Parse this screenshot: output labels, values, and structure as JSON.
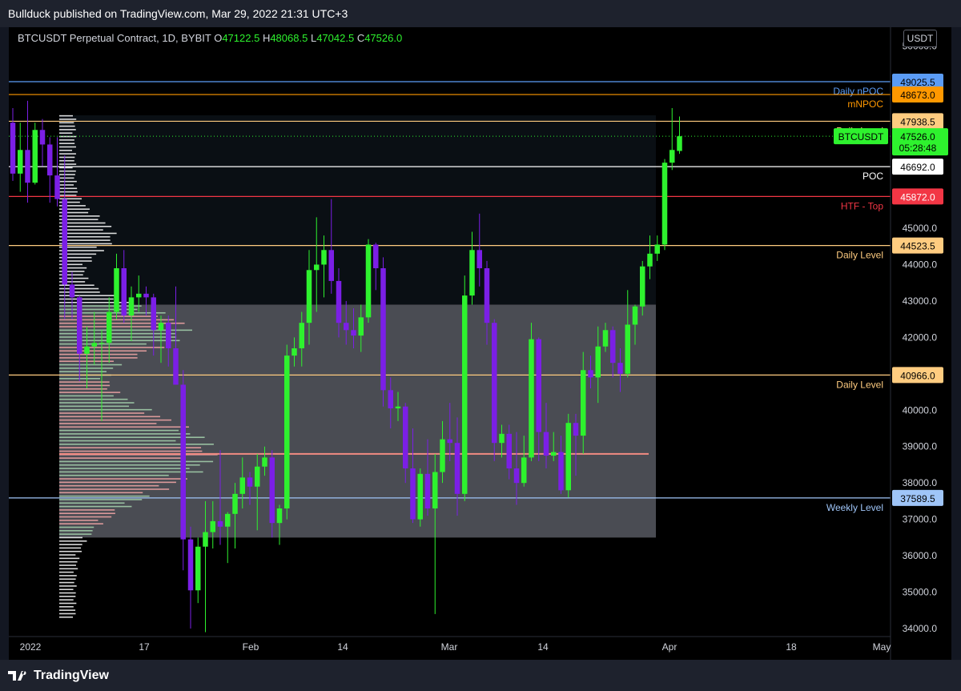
{
  "header": {
    "published": "Bullduck published on TradingView.com, Mar 29, 2022 21:31 UTC+3"
  },
  "legend": {
    "symbol": "BTCUSDT Perpetual Contract, 1D, BYBIT",
    "o_label": "O",
    "o": "47122.5",
    "h_label": "H",
    "h": "48068.5",
    "l_label": "L",
    "l": "47042.5",
    "c_label": "C",
    "c": "47526.0"
  },
  "currency": "USDT",
  "brand": "TradingView",
  "chart_data": {
    "type": "candlestick",
    "symbol": "BTCUSDT",
    "timeframe": "1D",
    "ylim": [
      34000,
      50000
    ],
    "y_ticks": [
      "34000.0",
      "35000.0",
      "36000.0",
      "37000.0",
      "38000.0",
      "39000.0",
      "40000.0",
      "41000.0",
      "42000.0",
      "43000.0",
      "44000.0",
      "45000.0",
      "50000.0"
    ],
    "x_ticks": [
      "2022",
      "17",
      "Feb",
      "14",
      "Mar",
      "14",
      "Apr",
      "18",
      "May"
    ],
    "last_price": "47526.0",
    "countdown": "05:28:48",
    "symbol_tag": "BTCUSDT",
    "levels": [
      {
        "value": 49025.5,
        "label": "Daily nPOC",
        "tag": "49025.5",
        "color": "#5b9cf6"
      },
      {
        "value": 48673.0,
        "label": "mNPOC",
        "tag": "48673.0",
        "color": "#ff9800"
      },
      {
        "value": 47938.5,
        "label": "Daily Level",
        "tag": "47938.5",
        "color": "#ffcc80"
      },
      {
        "value": 46692.0,
        "label": "POC",
        "tag": "46692.0",
        "color": "#ffffff"
      },
      {
        "value": 45872.0,
        "label": "HTF - Top",
        "tag": "45872.0",
        "color": "#f23645"
      },
      {
        "value": 44523.5,
        "label": "Daily Level",
        "tag": "44523.5",
        "color": "#ffcc80"
      },
      {
        "value": 40966.0,
        "label": "Daily Level",
        "tag": "40966.0",
        "color": "#ffcc80"
      },
      {
        "value": 37589.5,
        "label": "Weekly Level",
        "tag": "37589.5",
        "color": "#9fc5f8"
      }
    ],
    "value_area": {
      "high": 42900,
      "low": 36500
    },
    "profile_poc": 38800,
    "candles": [
      {
        "d": "2021-12-29",
        "o": 47900,
        "h": 48300,
        "l": 46300,
        "c": 46500
      },
      {
        "d": "2021-12-30",
        "o": 46500,
        "h": 47900,
        "l": 46000,
        "c": 47150
      },
      {
        "d": "2021-12-31",
        "o": 47150,
        "h": 48500,
        "l": 45700,
        "c": 46250
      },
      {
        "d": "2022-01-01",
        "o": 46250,
        "h": 47900,
        "l": 46200,
        "c": 47700
      },
      {
        "d": "2022-01-02",
        "o": 47700,
        "h": 48000,
        "l": 46700,
        "c": 47300
      },
      {
        "d": "2022-01-03",
        "o": 47300,
        "h": 47500,
        "l": 45700,
        "c": 46450
      },
      {
        "d": "2022-01-04",
        "o": 46450,
        "h": 47500,
        "l": 45600,
        "c": 45800
      },
      {
        "d": "2022-01-05",
        "o": 45800,
        "h": 47000,
        "l": 42500,
        "c": 43450
      },
      {
        "d": "2022-01-06",
        "o": 43450,
        "h": 43800,
        "l": 42500,
        "c": 43100
      },
      {
        "d": "2022-01-07",
        "o": 43100,
        "h": 43150,
        "l": 40800,
        "c": 41550
      },
      {
        "d": "2022-01-08",
        "o": 41550,
        "h": 42300,
        "l": 40600,
        "c": 41750
      },
      {
        "d": "2022-01-09",
        "o": 41750,
        "h": 42700,
        "l": 41250,
        "c": 41850
      },
      {
        "d": "2022-01-10",
        "o": 41850,
        "h": 42200,
        "l": 39700,
        "c": 41850
      },
      {
        "d": "2022-01-11",
        "o": 41850,
        "h": 43100,
        "l": 41300,
        "c": 42700
      },
      {
        "d": "2022-01-12",
        "o": 42700,
        "h": 44300,
        "l": 42500,
        "c": 43900
      },
      {
        "d": "2022-01-13",
        "o": 43900,
        "h": 44400,
        "l": 42400,
        "c": 42600
      },
      {
        "d": "2022-01-14",
        "o": 42600,
        "h": 43400,
        "l": 41900,
        "c": 43100
      },
      {
        "d": "2022-01-15",
        "o": 43100,
        "h": 43700,
        "l": 42700,
        "c": 43200
      },
      {
        "d": "2022-01-16",
        "o": 43200,
        "h": 43400,
        "l": 42600,
        "c": 43100
      },
      {
        "d": "2022-01-17",
        "o": 43100,
        "h": 43200,
        "l": 41500,
        "c": 42200
      },
      {
        "d": "2022-01-18",
        "o": 42200,
        "h": 42600,
        "l": 41300,
        "c": 42400
      },
      {
        "d": "2022-01-19",
        "o": 42400,
        "h": 42600,
        "l": 41200,
        "c": 41700
      },
      {
        "d": "2022-01-20",
        "o": 41700,
        "h": 43400,
        "l": 40700,
        "c": 40700
      },
      {
        "d": "2022-01-21",
        "o": 40700,
        "h": 41100,
        "l": 35600,
        "c": 36450
      },
      {
        "d": "2022-01-22",
        "o": 36450,
        "h": 36800,
        "l": 34000,
        "c": 35050
      },
      {
        "d": "2022-01-23",
        "o": 35050,
        "h": 36500,
        "l": 34700,
        "c": 36250
      },
      {
        "d": "2022-01-24",
        "o": 36250,
        "h": 37500,
        "l": 33900,
        "c": 36650
      },
      {
        "d": "2022-01-25",
        "o": 36650,
        "h": 37500,
        "l": 36200,
        "c": 36950
      },
      {
        "d": "2022-01-26",
        "o": 36950,
        "h": 38900,
        "l": 36300,
        "c": 36800
      },
      {
        "d": "2022-01-27",
        "o": 36800,
        "h": 37200,
        "l": 35800,
        "c": 37150
      },
      {
        "d": "2022-01-28",
        "o": 37150,
        "h": 38000,
        "l": 36200,
        "c": 37700
      },
      {
        "d": "2022-01-29",
        "o": 37700,
        "h": 38700,
        "l": 37300,
        "c": 38150
      },
      {
        "d": "2022-01-30",
        "o": 38150,
        "h": 38300,
        "l": 37400,
        "c": 37900
      },
      {
        "d": "2022-01-31",
        "o": 37900,
        "h": 38800,
        "l": 36700,
        "c": 38450
      },
      {
        "d": "2022-02-01",
        "o": 38450,
        "h": 39000,
        "l": 38200,
        "c": 38700
      },
      {
        "d": "2022-02-02",
        "o": 38700,
        "h": 38900,
        "l": 36500,
        "c": 36900
      },
      {
        "d": "2022-02-03",
        "o": 36900,
        "h": 37400,
        "l": 36300,
        "c": 37300
      },
      {
        "d": "2022-02-04",
        "o": 37300,
        "h": 41800,
        "l": 37000,
        "c": 41500
      },
      {
        "d": "2022-02-05",
        "o": 41500,
        "h": 42000,
        "l": 41200,
        "c": 41700
      },
      {
        "d": "2022-02-06",
        "o": 41700,
        "h": 42700,
        "l": 41200,
        "c": 42400
      },
      {
        "d": "2022-02-07",
        "o": 42400,
        "h": 44400,
        "l": 41800,
        "c": 43850
      },
      {
        "d": "2022-02-08",
        "o": 43850,
        "h": 45300,
        "l": 42700,
        "c": 44000
      },
      {
        "d": "2022-02-09",
        "o": 44000,
        "h": 44800,
        "l": 43100,
        "c": 44400
      },
      {
        "d": "2022-02-10",
        "o": 44400,
        "h": 45800,
        "l": 43200,
        "c": 43550
      },
      {
        "d": "2022-02-11",
        "o": 43550,
        "h": 43900,
        "l": 42000,
        "c": 42400
      },
      {
        "d": "2022-02-12",
        "o": 42400,
        "h": 43000,
        "l": 41800,
        "c": 42200
      },
      {
        "d": "2022-02-13",
        "o": 42200,
        "h": 42800,
        "l": 41700,
        "c": 42050
      },
      {
        "d": "2022-02-14",
        "o": 42050,
        "h": 42900,
        "l": 41600,
        "c": 42550
      },
      {
        "d": "2022-02-15",
        "o": 42550,
        "h": 44700,
        "l": 42400,
        "c": 44550
      },
      {
        "d": "2022-02-16",
        "o": 44550,
        "h": 44600,
        "l": 43300,
        "c": 43900
      },
      {
        "d": "2022-02-17",
        "o": 43900,
        "h": 44200,
        "l": 40100,
        "c": 40550
      },
      {
        "d": "2022-02-18",
        "o": 40550,
        "h": 40900,
        "l": 39500,
        "c": 40050
      },
      {
        "d": "2022-02-19",
        "o": 40050,
        "h": 40500,
        "l": 39700,
        "c": 40100
      },
      {
        "d": "2022-02-20",
        "o": 40100,
        "h": 40200,
        "l": 38000,
        "c": 38400
      },
      {
        "d": "2022-02-21",
        "o": 38400,
        "h": 39500,
        "l": 36900,
        "c": 37000
      },
      {
        "d": "2022-02-22",
        "o": 37000,
        "h": 38400,
        "l": 36800,
        "c": 38250
      },
      {
        "d": "2022-02-23",
        "o": 38250,
        "h": 39200,
        "l": 37100,
        "c": 37300
      },
      {
        "d": "2022-02-24",
        "o": 37300,
        "h": 38800,
        "l": 34400,
        "c": 38300
      },
      {
        "d": "2022-02-25",
        "o": 38300,
        "h": 39700,
        "l": 38000,
        "c": 39200
      },
      {
        "d": "2022-02-26",
        "o": 39200,
        "h": 40200,
        "l": 38600,
        "c": 39100
      },
      {
        "d": "2022-02-27",
        "o": 39100,
        "h": 39800,
        "l": 37100,
        "c": 37700
      },
      {
        "d": "2022-02-28",
        "o": 37700,
        "h": 43700,
        "l": 37500,
        "c": 43150
      },
      {
        "d": "2022-03-01",
        "o": 43150,
        "h": 44900,
        "l": 42900,
        "c": 44400
      },
      {
        "d": "2022-03-02",
        "o": 44400,
        "h": 45400,
        "l": 43400,
        "c": 43900
      },
      {
        "d": "2022-03-03",
        "o": 43900,
        "h": 44100,
        "l": 41800,
        "c": 42400
      },
      {
        "d": "2022-03-04",
        "o": 42400,
        "h": 42500,
        "l": 38600,
        "c": 39100
      },
      {
        "d": "2022-03-05",
        "o": 39100,
        "h": 39600,
        "l": 38700,
        "c": 39350
      },
      {
        "d": "2022-03-06",
        "o": 39350,
        "h": 39600,
        "l": 38100,
        "c": 38400
      },
      {
        "d": "2022-03-07",
        "o": 38400,
        "h": 39400,
        "l": 37400,
        "c": 38000
      },
      {
        "d": "2022-03-08",
        "o": 38000,
        "h": 39300,
        "l": 37900,
        "c": 38700
      },
      {
        "d": "2022-03-09",
        "o": 38700,
        "h": 42400,
        "l": 38600,
        "c": 41950
      },
      {
        "d": "2022-03-10",
        "o": 41950,
        "h": 42000,
        "l": 38600,
        "c": 39400
      },
      {
        "d": "2022-03-11",
        "o": 39400,
        "h": 40200,
        "l": 38400,
        "c": 38750
      },
      {
        "d": "2022-03-12",
        "o": 38750,
        "h": 39400,
        "l": 38600,
        "c": 38850
      },
      {
        "d": "2022-03-13",
        "o": 38850,
        "h": 39300,
        "l": 37700,
        "c": 37800
      },
      {
        "d": "2022-03-14",
        "o": 37800,
        "h": 39900,
        "l": 37600,
        "c": 39650
      },
      {
        "d": "2022-03-15",
        "o": 39650,
        "h": 39900,
        "l": 38200,
        "c": 39300
      },
      {
        "d": "2022-03-16",
        "o": 39300,
        "h": 41600,
        "l": 38800,
        "c": 41100
      },
      {
        "d": "2022-03-17",
        "o": 41100,
        "h": 41500,
        "l": 40600,
        "c": 40900
      },
      {
        "d": "2022-03-18",
        "o": 40900,
        "h": 42300,
        "l": 40200,
        "c": 41750
      },
      {
        "d": "2022-03-19",
        "o": 41750,
        "h": 42400,
        "l": 41600,
        "c": 42200
      },
      {
        "d": "2022-03-20",
        "o": 42200,
        "h": 42300,
        "l": 40900,
        "c": 41300
      },
      {
        "d": "2022-03-21",
        "o": 41300,
        "h": 41700,
        "l": 40500,
        "c": 41000
      },
      {
        "d": "2022-03-22",
        "o": 41000,
        "h": 43300,
        "l": 40900,
        "c": 42350
      },
      {
        "d": "2022-03-23",
        "o": 42350,
        "h": 42900,
        "l": 41800,
        "c": 42850
      },
      {
        "d": "2022-03-24",
        "o": 42850,
        "h": 44100,
        "l": 42600,
        "c": 43950
      },
      {
        "d": "2022-03-25",
        "o": 43950,
        "h": 44800,
        "l": 43600,
        "c": 44300
      },
      {
        "d": "2022-03-26",
        "o": 44300,
        "h": 44800,
        "l": 44100,
        "c": 44550
      },
      {
        "d": "2022-03-27",
        "o": 44550,
        "h": 46900,
        "l": 44400,
        "c": 46800
      },
      {
        "d": "2022-03-28",
        "o": 46800,
        "h": 48300,
        "l": 46600,
        "c": 47150
      },
      {
        "d": "2022-03-29",
        "o": 47122.5,
        "h": 48068.5,
        "l": 47042.5,
        "c": 47526.0
      }
    ]
  }
}
